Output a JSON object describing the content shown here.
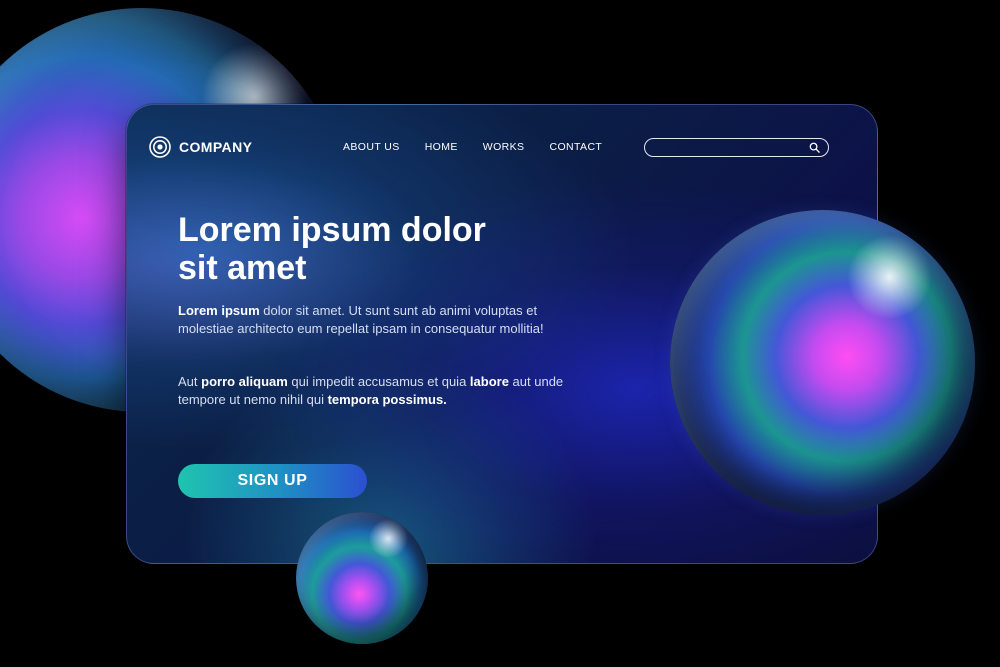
{
  "brand": {
    "name": "COMPANY",
    "logo_icon": "concentric-circle-icon"
  },
  "nav": {
    "items": [
      {
        "label": "ABOUT US"
      },
      {
        "label": "HOME"
      },
      {
        "label": "WORKS"
      },
      {
        "label": "CONTACT"
      }
    ]
  },
  "search": {
    "value": "",
    "placeholder": "",
    "icon": "search-icon"
  },
  "hero": {
    "title_line_1": "Lorem ipsum dolor",
    "title_line_2": "sit amet",
    "paragraph_1": {
      "bold": "Lorem ipsum",
      "text": " dolor sit amet. Ut sunt sunt ab animi voluptas et molestiae architecto eum repellat ipsam in consequatur mollitia!"
    },
    "paragraph_2": {
      "t1": "Aut ",
      "b1": "porro aliquam",
      "t2": " qui impedit accusamus et quia ",
      "b2": "labore",
      "t3": " aut unde tempore ut nemo nihil qui ",
      "b3": "tempora possimus."
    },
    "cta_label": "SIGN UP"
  },
  "colors": {
    "background": "#000000",
    "card": "#0b1f45",
    "accent_start": "#1fc4b0",
    "accent_end": "#2b4fd0",
    "text": "#ffffff"
  }
}
